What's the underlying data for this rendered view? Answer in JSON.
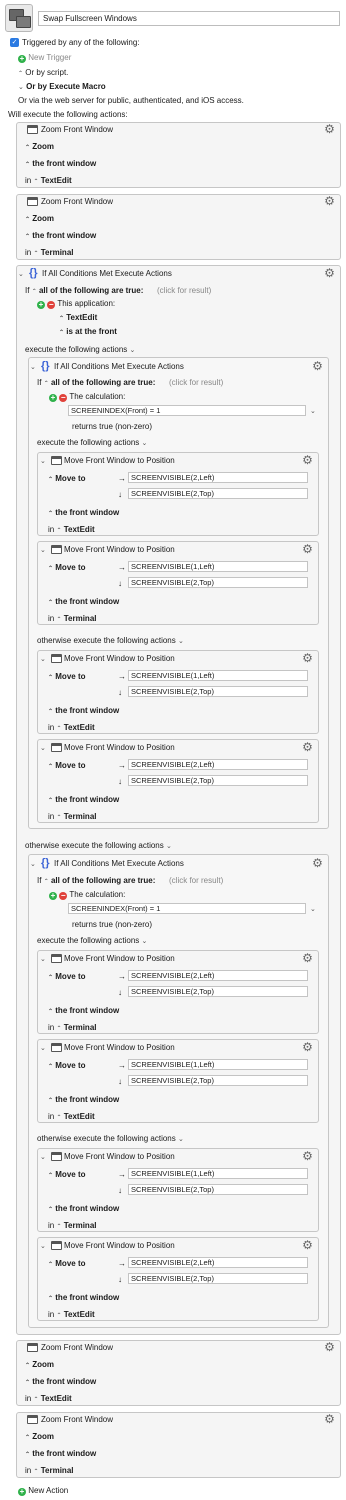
{
  "macro": {
    "title": "Swap Fullscreen Windows",
    "triggered_label": "Triggered by any of the following:",
    "new_trigger": "New Trigger",
    "or_by_script": "Or by script.",
    "or_by_execute_macro": "Or by Execute Macro",
    "web_server_text": "Or via the web server for public, authenticated, and iOS access.",
    "will_execute": "Will execute the following actions:",
    "new_action": "New Action"
  },
  "labels": {
    "zoom_front_window": "Zoom Front Window",
    "zoom": "Zoom",
    "the_front_window": "the front window",
    "in": "in",
    "if_all_conditions": "If All Conditions Met Execute Actions",
    "if": "If",
    "all_of_following_true": "all of the following are true:",
    "click_for_result": "(click for result)",
    "this_application": "This application:",
    "is_at_the_front": "is at the front",
    "execute_following": "execute the following actions",
    "otherwise_execute": "otherwise execute the following actions",
    "the_calculation": "The calculation:",
    "returns_true": "returns true (non-zero)",
    "move_front_window": "Move Front Window to Position",
    "move_to": "Move to",
    "arrow_right": "→",
    "arrow_down": "↓"
  },
  "apps": {
    "textedit": "TextEdit",
    "terminal": "Terminal"
  },
  "calc": {
    "front_index": "SCREENINDEX(Front) = 1"
  },
  "screen": {
    "left1": "SCREENVISIBLE(1,Left)",
    "left2": "SCREENVISIBLE(2,Left)",
    "top2": "SCREENVISIBLE(2,Top)"
  },
  "colors": {
    "checkbox_blue": "#2a7ae2",
    "plus_green": "#2fb14a",
    "minus_red": "#e0413a",
    "brace_blue": "#3b63d6"
  }
}
